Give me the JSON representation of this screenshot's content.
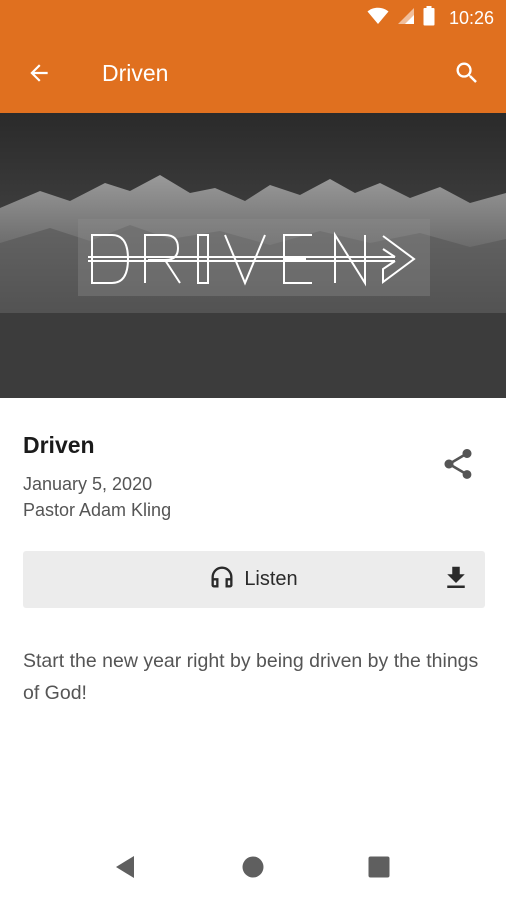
{
  "status_bar": {
    "time": "10:26",
    "icons": [
      "wifi-icon",
      "signal-icon",
      "battery-icon"
    ]
  },
  "app_bar": {
    "title": "Driven",
    "back_icon": "arrow-back-icon",
    "search_icon": "search-icon"
  },
  "hero": {
    "artwork_text": "DRIVEN"
  },
  "sermon": {
    "title": "Driven",
    "date": "January 5, 2020",
    "speaker": "Pastor Adam Kling",
    "share_icon": "share-icon"
  },
  "listen": {
    "label": "Listen",
    "icon": "headphones-icon",
    "download_icon": "download-icon"
  },
  "description": "Start the new year right by being driven by the things of God!",
  "nav_bar": {
    "icons": [
      "nav-back-icon",
      "nav-home-icon",
      "nav-recents-icon"
    ]
  },
  "colors": {
    "accent": "#e0701f",
    "listen_bg": "#ececec",
    "text_primary": "#1b1b1b",
    "text_secondary": "#555555"
  }
}
